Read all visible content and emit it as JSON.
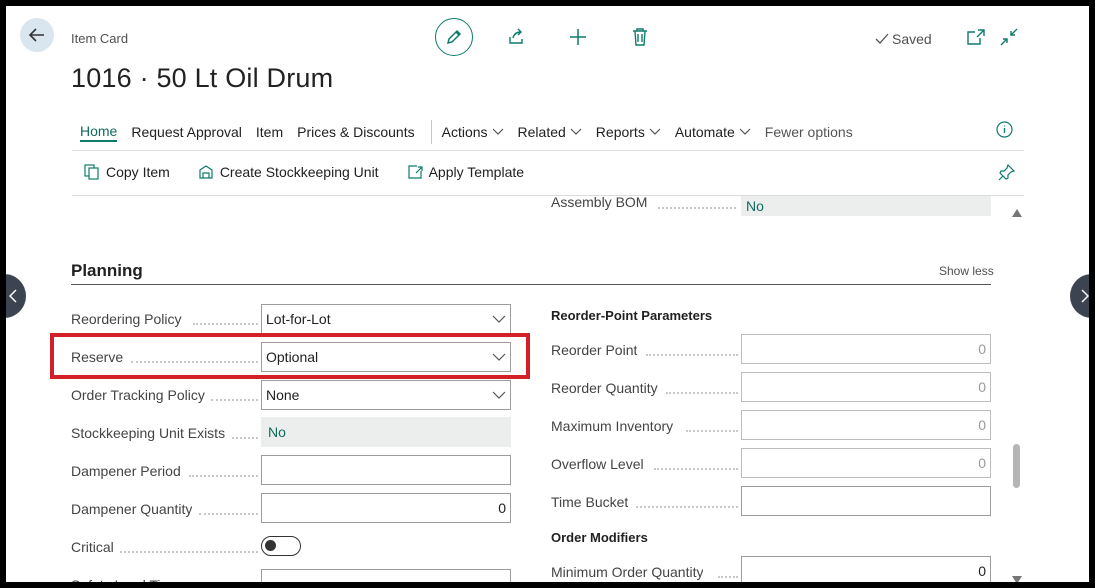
{
  "header": {
    "breadcrumb": "Item Card",
    "title": "1016 · 50 Lt Oil Drum",
    "saved_label": "Saved"
  },
  "nav": {
    "items": [
      "Home",
      "Request Approval",
      "Item",
      "Prices & Discounts"
    ],
    "menus": [
      "Actions",
      "Related",
      "Reports",
      "Automate"
    ],
    "fewer": "Fewer options"
  },
  "actions": {
    "copy_item": "Copy Item",
    "create_sku": "Create Stockkeeping Unit",
    "apply_template": "Apply Template"
  },
  "top_row": {
    "assembly_bom_label": "Assembly BOM",
    "assembly_bom_value": "No"
  },
  "planning": {
    "title": "Planning",
    "show_less": "Show less",
    "left": {
      "reordering_policy": {
        "label": "Reordering Policy",
        "value": "Lot-for-Lot"
      },
      "reserve": {
        "label": "Reserve",
        "value": "Optional"
      },
      "order_tracking_policy": {
        "label": "Order Tracking Policy",
        "value": "None"
      },
      "sku_exists": {
        "label": "Stockkeeping Unit Exists",
        "value": "No"
      },
      "dampener_period": {
        "label": "Dampener Period",
        "value": ""
      },
      "dampener_quantity": {
        "label": "Dampener Quantity",
        "value": "0"
      },
      "critical": {
        "label": "Critical",
        "value": "off"
      },
      "safety_lead_time": {
        "label": "Safety Lead Time",
        "value": ""
      }
    },
    "right": {
      "reorder_point_params_title": "Reorder-Point Parameters",
      "reorder_point": {
        "label": "Reorder Point",
        "value": "0"
      },
      "reorder_quantity": {
        "label": "Reorder Quantity",
        "value": "0"
      },
      "maximum_inventory": {
        "label": "Maximum Inventory",
        "value": "0"
      },
      "overflow_level": {
        "label": "Overflow Level",
        "value": "0"
      },
      "time_bucket": {
        "label": "Time Bucket",
        "value": ""
      },
      "order_modifiers_title": "Order Modifiers",
      "minimum_order_quantity": {
        "label": "Minimum Order Quantity",
        "value": "0"
      }
    }
  },
  "colors": {
    "accent": "#0f7b6c",
    "highlight": "#d12028"
  }
}
